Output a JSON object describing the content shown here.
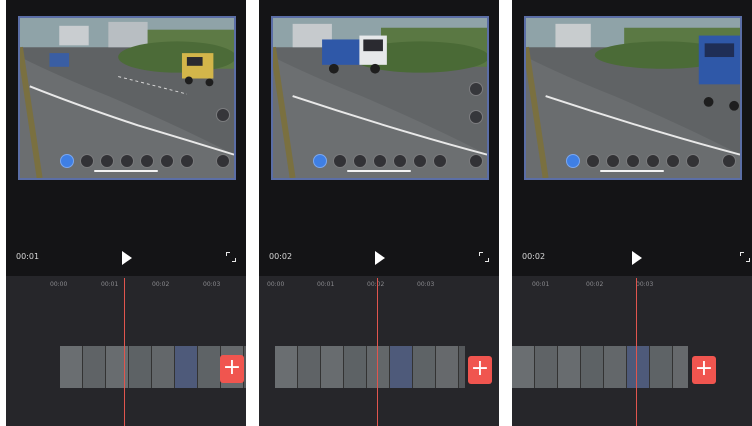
{
  "screens": [
    {
      "time": "00:01",
      "ruler": [
        "00:00",
        "00:01",
        "00:02",
        "00:03"
      ]
    },
    {
      "time": "00:02",
      "ruler": [
        "00:00",
        "00:01",
        "00:02",
        "00:03"
      ]
    },
    {
      "time": "00:02",
      "ruler": [
        "00:01",
        "00:02",
        "00:03"
      ]
    }
  ],
  "add_button_label": "+",
  "icons": {
    "play": "play-icon",
    "fullscreen": "fullscreen-icon",
    "add": "plus-icon"
  },
  "colors": {
    "panel_bg": "#141416",
    "timeline_bg": "#26262a",
    "playhead": "#e0554e",
    "add_button": "#f0554f",
    "active_control": "#3f7fe4",
    "video_border": "#5b6ea6"
  }
}
